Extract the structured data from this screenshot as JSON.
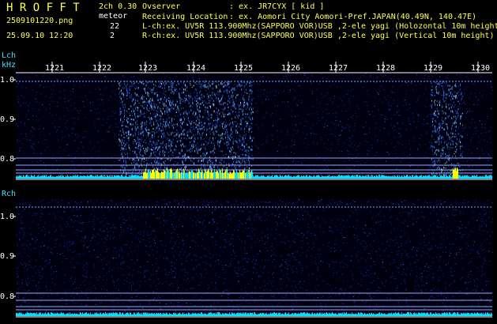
{
  "header": {
    "logo": "H R O F F T",
    "channels": "2ch 0.30",
    "filename": "2509101220.png",
    "mode": "meteor",
    "count_l": "22",
    "count_r": "2",
    "datetime": "25.09.10 12:20",
    "observer_label": "Ovserver",
    "observer_value": ": ex. JR7CYX [ kid ]",
    "location_label": "Receiving Location",
    "location_value": ": ex. Aomori City Aomori-Pref.JAPAN(40.49N, 140.47E)",
    "lch_info": "L-ch:ex. UV5R 113.900Mhz(SAPPORO VOR)USB ,2-ele yagi (Holozontal 10m height)",
    "rch_info": "R-ch:ex. UV5R 113.900Mhz(SAPPORO VOR)USB ,2-ele yagi (Vertical 10m height)"
  },
  "time_axis": {
    "ticks": [
      "1221",
      "1222",
      "1223",
      "1224",
      "1225",
      "1226",
      "1227",
      "1228",
      "1229",
      "1230"
    ]
  },
  "panels": [
    {
      "channel": "Lch",
      "unit": "kHz",
      "yticks": [
        "1.0",
        "0.9",
        "0.8"
      ]
    },
    {
      "channel": "Rch",
      "unit": "",
      "yticks": [
        "1.0",
        "0.9",
        "0.8"
      ]
    }
  ],
  "colors": {
    "background": "#000000",
    "noise": "#1a2aa0",
    "meteor": "#4fb8ff",
    "bar": "#00e0ff",
    "bar_hot": "#ffff00",
    "grid": "#9aa6ff",
    "text_yellow": "#ffff55",
    "text_cyan": "#40e0ff"
  }
}
